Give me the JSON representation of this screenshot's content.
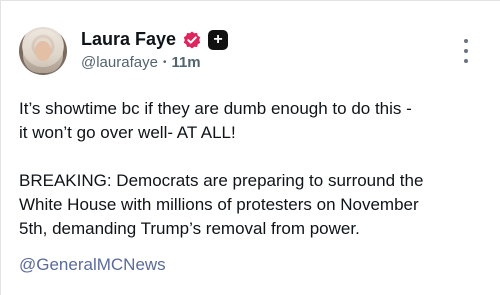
{
  "post": {
    "author_name": "Laura Faye",
    "handle": "@laurafaye",
    "separator": "•",
    "time": "11m",
    "paragraph_1": "It’s showtime bc if they are dumb enough to do this -\nit won’t go over well- AT ALL!",
    "paragraph_2": "BREAKING: Democrats are preparing to surround the\nWhite House with millions of protesters on November\n5th, demanding Trump’s removal from power.",
    "mention": "@GeneralMCNews"
  },
  "badges": {
    "verified_icon": "verified-badge-icon",
    "plus_icon": "plus-badge-icon",
    "plus_glyph": "+",
    "verified_color": "#e0245e"
  },
  "menu_icon": "more-vertical-icon"
}
